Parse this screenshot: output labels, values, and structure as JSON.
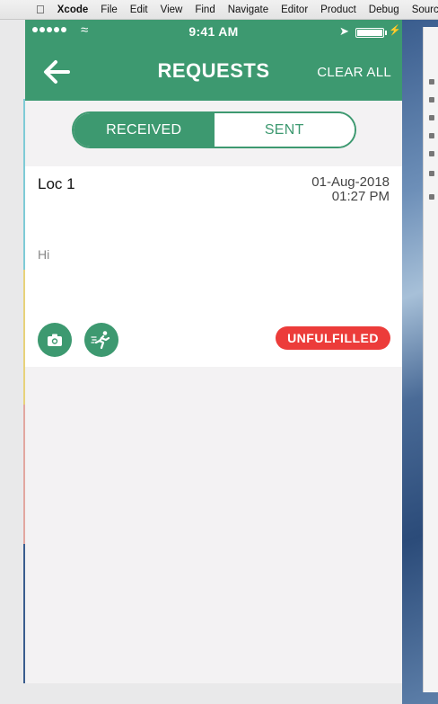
{
  "menubar": {
    "app_name": "Xcode",
    "items": [
      "File",
      "Edit",
      "View",
      "Find",
      "Navigate",
      "Editor",
      "Product",
      "Debug",
      "Source Control"
    ]
  },
  "status_bar": {
    "time": "9:41 AM"
  },
  "navbar": {
    "title": "REQUESTS",
    "action_label": "CLEAR ALL"
  },
  "segments": {
    "received_label": "RECEIVED",
    "sent_label": "SENT",
    "selected": "RECEIVED"
  },
  "request_card": {
    "location": "Loc 1",
    "date": "01-Aug-2018",
    "time": "01:27 PM",
    "message": "Hi",
    "status": "UNFULFILLED"
  },
  "icons": {
    "back": "arrow-left-icon",
    "camera": "camera-icon",
    "runner": "running-person-icon"
  },
  "colors": {
    "primary_green": "#3d9970",
    "status_red": "#ec3c3a",
    "background": "#f3f2f3"
  }
}
